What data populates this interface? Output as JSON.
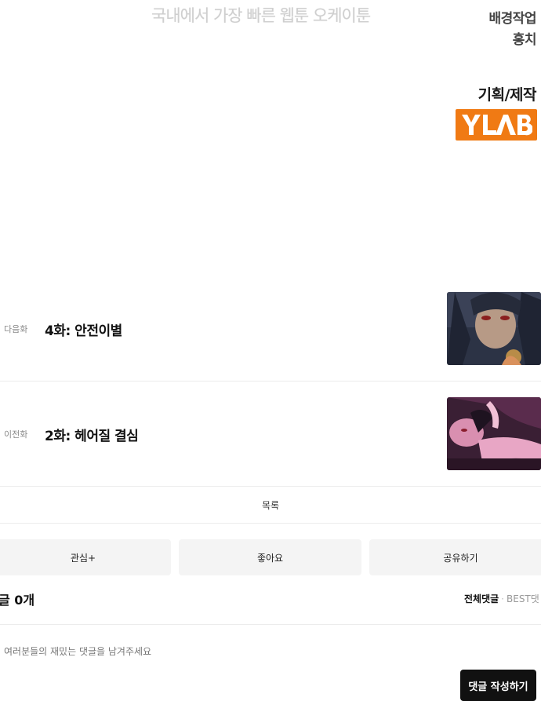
{
  "banner": {
    "watermark": "국내에서 가장 빠른 웹툰 오케이툰"
  },
  "credits": {
    "background_role": "배경작업",
    "background_name": "홍치",
    "production_role": "기획/제작",
    "production_logo": "YLAB",
    "logo_color": "#f07a14"
  },
  "episodes": [
    {
      "direction": "다음화",
      "title": "4화: 안전이별",
      "thumb_icon": "episode-4-thumbnail"
    },
    {
      "direction": "이전화",
      "title": "2화: 헤어질 결심",
      "thumb_icon": "episode-2-thumbnail"
    }
  ],
  "list_label": "목록",
  "actions": {
    "favorite": "관심+",
    "like": "좋아요",
    "share": "공유하기"
  },
  "comments": {
    "header": "글 0개",
    "sort_all": "전체댓글",
    "sort_separator": "·",
    "sort_best": "BEST댓",
    "placeholder": "여러분들의 재밌는 댓글을 남겨주세요",
    "write_button": "댓글 작성하기"
  }
}
